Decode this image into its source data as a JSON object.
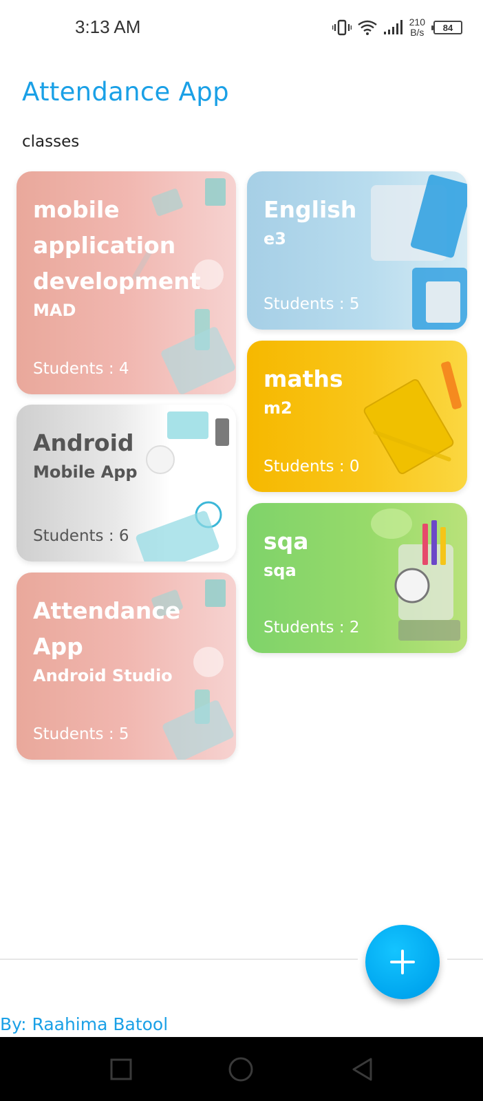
{
  "status_bar": {
    "time": "3:13 AM",
    "net_speed_value": "210",
    "net_speed_unit": "B/s",
    "battery": "84"
  },
  "header": {
    "title": "Attendance App",
    "section": "classes"
  },
  "classes": [
    {
      "name": "mobile application development",
      "code": "MAD",
      "students": "Students : 4"
    },
    {
      "name": "English",
      "code": "e3",
      "students": "Students : 5"
    },
    {
      "name": "maths",
      "code": "m2",
      "students": "Students : 0"
    },
    {
      "name": "Android",
      "code": "Mobile App",
      "students": "Students : 6"
    },
    {
      "name": "sqa",
      "code": "sqa",
      "students": "Students : 2"
    },
    {
      "name": "Attendance App",
      "code": "Android Studio",
      "students": "Students : 5"
    }
  ],
  "footer": {
    "author": "By: Raahima Batool",
    "fab_icon": "plus-icon"
  },
  "nav": {
    "recent_icon": "square-icon",
    "home_icon": "circle-icon",
    "back_icon": "triangle-back-icon"
  },
  "colors": {
    "accent": "#1aa0e6",
    "fab": "#00a6ef"
  }
}
